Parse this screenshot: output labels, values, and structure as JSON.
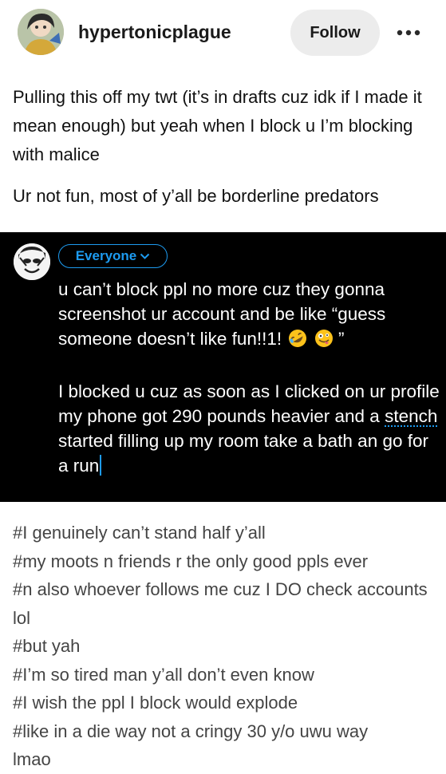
{
  "header": {
    "username": "hypertonicplague",
    "follow_label": "Follow",
    "more_icon": "more-horizontal-icon"
  },
  "post": {
    "paragraphs": [
      "Pulling this off my twt (it’s in drafts cuz idk if I made it mean enough) but yeah when I block u I’m blocking with malice",
      "Ur not fun, most of y’all be borderline predators"
    ]
  },
  "tweet": {
    "audience_label": "Everyone",
    "line1_text": "u can’t block ppl no more cuz they gonna screenshot ur account and be like “guess someone doesn’t like fun!!1!",
    "line1_close_quote": "”",
    "line2_before": "I blocked u cuz as soon as I clicked on ur profile my phone got 290 pounds heavier and a",
    "line2_misspelled": "stench",
    "line2_after": "started filling up my room take a bath an go for a run",
    "emojis": [
      "rofl-emoji",
      "zany-face-emoji"
    ],
    "accent_color": "#1d9bf0",
    "background_color": "#000000"
  },
  "tags": [
    "#I genuinely can’t stand half y’all",
    "#my moots n friends r the only good ppls ever",
    "#n also whoever follows me cuz I DO check accounts lol",
    "#but yah",
    "#I’m so tired man y’all don’t even know",
    "#I wish the ppl I block would explode",
    "#like in a die way not a cringy 30 y/o uwu way",
    "lmao"
  ]
}
